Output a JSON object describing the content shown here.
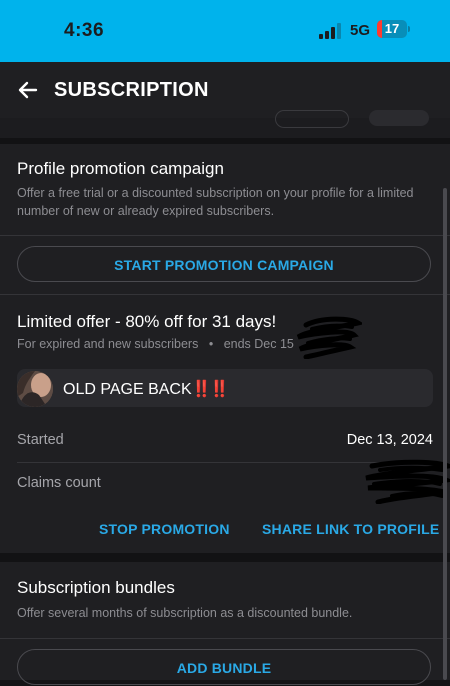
{
  "status_bar": {
    "time": "4:36",
    "network": "5G",
    "battery": "17"
  },
  "header": {
    "title": "SUBSCRIPTION",
    "back_icon": "arrow-left-icon"
  },
  "promotion_campaign": {
    "title": "Profile promotion campaign",
    "description": "Offer a free trial or a discounted subscription on your profile for a limited number of new or already expired subscribers.",
    "start_button": "START PROMOTION CAMPAIGN"
  },
  "limited_offer": {
    "title": "Limited offer - 80% off for 31 days!",
    "audience": "For expired and new subscribers",
    "ends": "ends Dec 15",
    "message_text": "OLD PAGE BACK",
    "message_emoji": "‼️‼️",
    "started_label": "Started",
    "started_value": "Dec 13, 2024",
    "claims_label": "Claims count",
    "stop_button": "STOP PROMOTION",
    "share_button": "SHARE LINK TO PROFILE"
  },
  "bundles": {
    "title": "Subscription bundles",
    "description": "Offer several months of subscription as a discounted bundle.",
    "add_button": "ADD BUNDLE"
  },
  "colors": {
    "status_bar_bg": "#00b3ec",
    "accent": "#2aa9e6",
    "background": "#1f1f22",
    "battery_low": "#ff3b30"
  }
}
